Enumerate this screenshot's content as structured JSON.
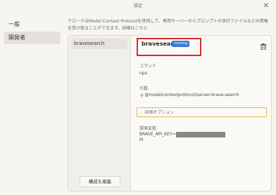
{
  "window": {
    "title": "設定"
  },
  "sidebar": {
    "items": [
      {
        "label": "一般"
      },
      {
        "label": "開発者"
      }
    ]
  },
  "description": "クロードはModel Context Protocolを使用して、専用サーバーからプロンプトや添付ファイルなどの情報を受け取ることができます。詳細はこちら",
  "servers": [
    {
      "name": "bravesearch"
    }
  ],
  "edit_button": "構成を編集",
  "detail": {
    "name": "bravesearch",
    "status": "running",
    "command_label": "コマンド",
    "command_value": "npx",
    "args_label": "引数",
    "args_value": "-y @modelcontextprotocol/server-brave-search",
    "advanced_label": "詳細オプション",
    "env_label": "環境変数",
    "env_key": "BRAVE_API_KEY=",
    "env_tail": "M"
  },
  "colors": {
    "highlight": "#d92b2b",
    "badge": "#3a7bd5",
    "focus": "#e7b84a"
  }
}
